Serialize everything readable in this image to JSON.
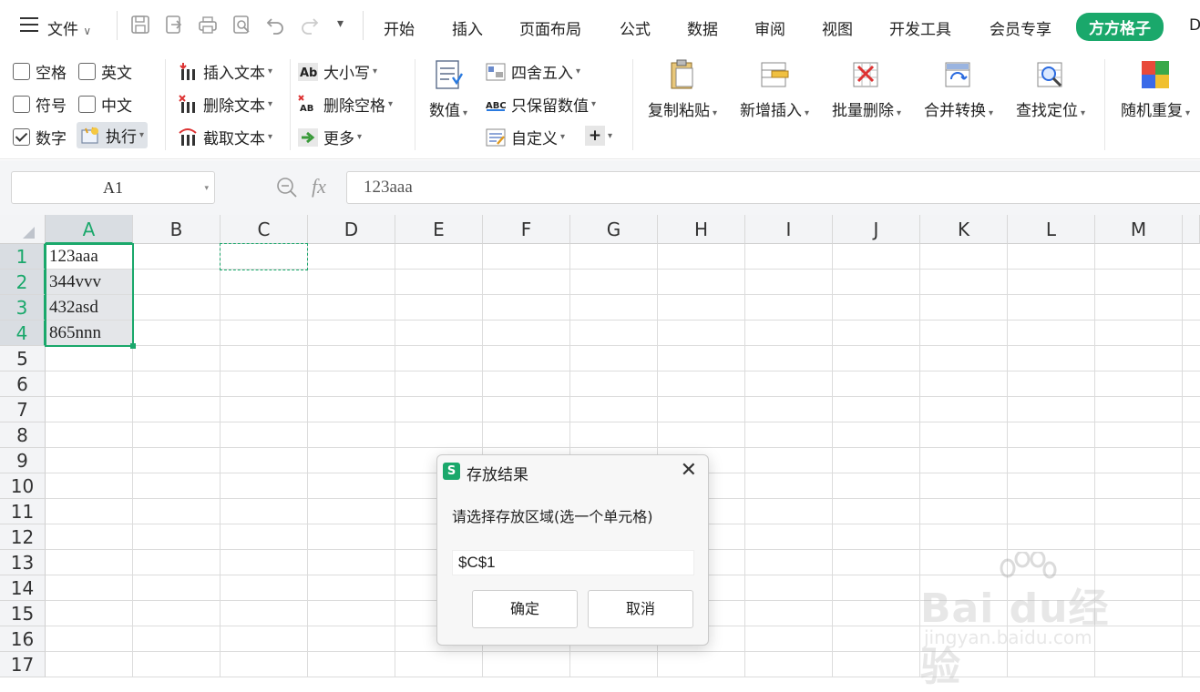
{
  "menu": {
    "file_label": "文件",
    "tabs": [
      "开始",
      "插入",
      "页面布局",
      "公式",
      "数据",
      "审阅",
      "视图",
      "开发工具",
      "会员专享",
      "方方格子",
      "D"
    ],
    "active_tab": "方方格子"
  },
  "ribbon": {
    "checkboxes": [
      {
        "label": "空格",
        "checked": false
      },
      {
        "label": "英文",
        "checked": false
      },
      {
        "label": "符号",
        "checked": false
      },
      {
        "label": "中文",
        "checked": false
      },
      {
        "label": "数字",
        "checked": true
      }
    ],
    "execute_label": "执行",
    "text_ops": [
      "插入文本",
      "删除文本",
      "截取文本"
    ],
    "case_ops": [
      "大小写",
      "删除空格",
      "更多"
    ],
    "value_label": "数值",
    "round_ops": [
      "四舍五入",
      "只保留数值",
      "自定义"
    ],
    "big_buttons": [
      "复制粘贴",
      "新增插入",
      "批量删除",
      "合并转换",
      "查找定位",
      "随机重复"
    ]
  },
  "formula_bar": {
    "name_box": "A1",
    "fx_label": "fx",
    "content": "123aaa"
  },
  "sheet": {
    "columns": [
      "A",
      "B",
      "C",
      "D",
      "E",
      "F",
      "G",
      "H",
      "I",
      "J",
      "K",
      "L",
      "M"
    ],
    "rows": [
      "1",
      "2",
      "3",
      "4",
      "5",
      "6",
      "7",
      "8",
      "9",
      "10",
      "11",
      "12",
      "13",
      "14",
      "15",
      "16",
      "17"
    ],
    "cells_A": [
      "123aaa",
      "344vvv",
      "432asd",
      "865nnn"
    ]
  },
  "dialog": {
    "title": "存放结果",
    "logo": "S",
    "prompt": "请选择存放区域(选一个单元格)",
    "value": "$C$1",
    "ok_label": "确定",
    "cancel_label": "取消"
  },
  "watermark": {
    "main": "Bai du经验",
    "sub": "jingyan.baidu.com"
  },
  "colors": {
    "accent": "#1aa86b",
    "header_bg": "#f3f4f6",
    "selected_header_bg": "#d9dde2"
  }
}
